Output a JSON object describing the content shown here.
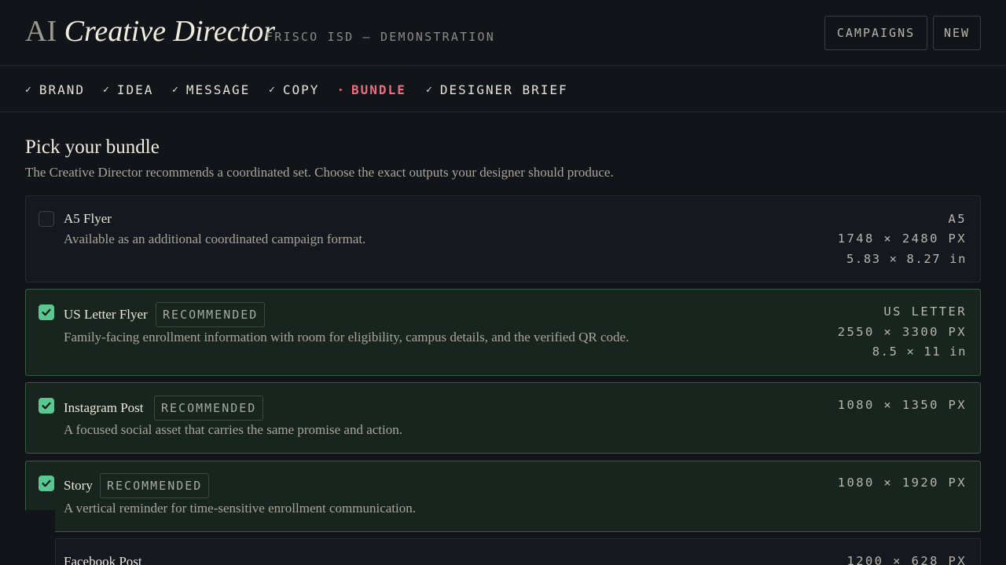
{
  "header": {
    "brand_ai": "AI",
    "brand_rest": "Creative Director",
    "subtitle": "FRISCO ISD — DEMONSTRATION",
    "campaigns_label": "CAMPAIGNS",
    "new_label": "NEW"
  },
  "steps": [
    {
      "mark": "✓",
      "label": "BRAND",
      "state": "done"
    },
    {
      "mark": "✓",
      "label": "IDEA",
      "state": "done"
    },
    {
      "mark": "✓",
      "label": "MESSAGE",
      "state": "done"
    },
    {
      "mark": "✓",
      "label": "COPY",
      "state": "done"
    },
    {
      "mark": "▸",
      "label": "BUNDLE",
      "state": "active"
    },
    {
      "mark": "✓",
      "label": "DESIGNER BRIEF",
      "state": "done"
    }
  ],
  "main": {
    "title": "Pick your bundle",
    "description": "The Creative Director recommends a coordinated set. Choose the exact outputs your designer should produce."
  },
  "formats": [
    {
      "name": "A5 Flyer",
      "checked": false,
      "badge": "",
      "description": "Available as an additional coordinated campaign format.",
      "spec_name": "A5",
      "spec_px": "1748 × 2480 PX",
      "spec_in": "5.83 × 8.27 in"
    },
    {
      "name": "US Letter Flyer",
      "checked": true,
      "badge": "RECOMMENDED",
      "description": "Family-facing enrollment information with room for eligibility, campus details, and the verified QR code.",
      "spec_name": "US LETTER",
      "spec_px": "2550 × 3300 PX",
      "spec_in": "8.5 × 11 in"
    },
    {
      "name": "Instagram Post",
      "checked": true,
      "badge": "RECOMMENDED",
      "description": "A focused social asset that carries the same promise and action.",
      "spec_px": "1080 × 1350 PX"
    },
    {
      "name": "Story",
      "checked": true,
      "badge": "RECOMMENDED",
      "description": "A vertical reminder for time-sensitive enrollment communication.",
      "spec_px": "1080 × 1920 PX"
    },
    {
      "name": "Facebook Post",
      "checked": false,
      "spec_px": "1200 × 628 PX"
    }
  ],
  "colors": {
    "background": "#111419",
    "accent_active_step": "#ef6b7d",
    "check_green": "#5ac690",
    "selected_card_bg": "#18251f",
    "selected_card_border": "#2f5d45"
  }
}
